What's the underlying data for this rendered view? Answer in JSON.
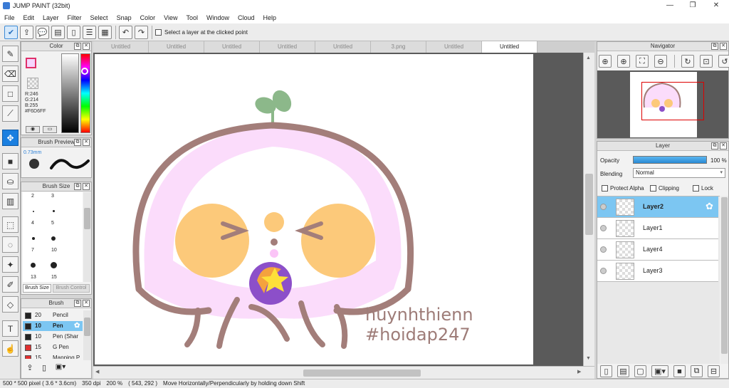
{
  "window": {
    "title": "JUMP PAINT (32bit)"
  },
  "menu": [
    "File",
    "Edit",
    "Layer",
    "Filter",
    "Select",
    "Snap",
    "Color",
    "View",
    "Tool",
    "Window",
    "Cloud",
    "Help"
  ],
  "toolbar": {
    "checkbox_label": "Select a layer at the clicked point"
  },
  "tabs": [
    "Untitled",
    "Untitled",
    "Untitled",
    "Untitled",
    "Untitled",
    "3.png",
    "Untitled",
    "Untitled"
  ],
  "active_tab_index": 7,
  "color_panel": {
    "title": "Color",
    "r": "R:246",
    "g": "G:214",
    "b": "B:255",
    "hex": "#F6D6FF",
    "primary_color": "#F6D6FF"
  },
  "brush_preview": {
    "title": "Brush Preview",
    "size": "0.73mm"
  },
  "brush_size": {
    "title": "Brush Size",
    "sizes": [
      "2",
      "3",
      "4",
      "5",
      "7",
      "10",
      "13",
      "15"
    ],
    "tab_active": "Brush Size",
    "tab_inactive": "Brush Control"
  },
  "brush_panel": {
    "title": "Brush",
    "items": [
      {
        "size": "20",
        "name": "Pencil",
        "color": "#222222"
      },
      {
        "size": "10",
        "name": "Pen",
        "color": "#222222",
        "selected": true
      },
      {
        "size": "10",
        "name": "Pen (Shar",
        "color": "#222222"
      },
      {
        "size": "15",
        "name": "G Pen",
        "color": "#e03030"
      },
      {
        "size": "15",
        "name": "Mapping P",
        "color": "#e03030"
      }
    ]
  },
  "navigator": {
    "title": "Navigator"
  },
  "layer_panel": {
    "title": "Layer",
    "opacity_label": "Opacity",
    "opacity_value": "100 %",
    "blending_label": "Blending",
    "blending_value": "Normal",
    "protect_alpha": "Protect Alpha",
    "clipping": "Clipping",
    "lock": "Lock",
    "layers": [
      "Layer2",
      "Layer1",
      "Layer4",
      "Layer3"
    ]
  },
  "canvas_text": {
    "line1": "huynhthienn",
    "line2": "#hoidap247"
  },
  "status": {
    "size": "500 * 500 pixel  ( 3.6 * 3.6cm)",
    "dpi": "350 dpi",
    "zoom": "200 %",
    "coords": "( 543, 292 )",
    "hint": "Move Horizontally/Perpendicularly by holding down Shift"
  }
}
